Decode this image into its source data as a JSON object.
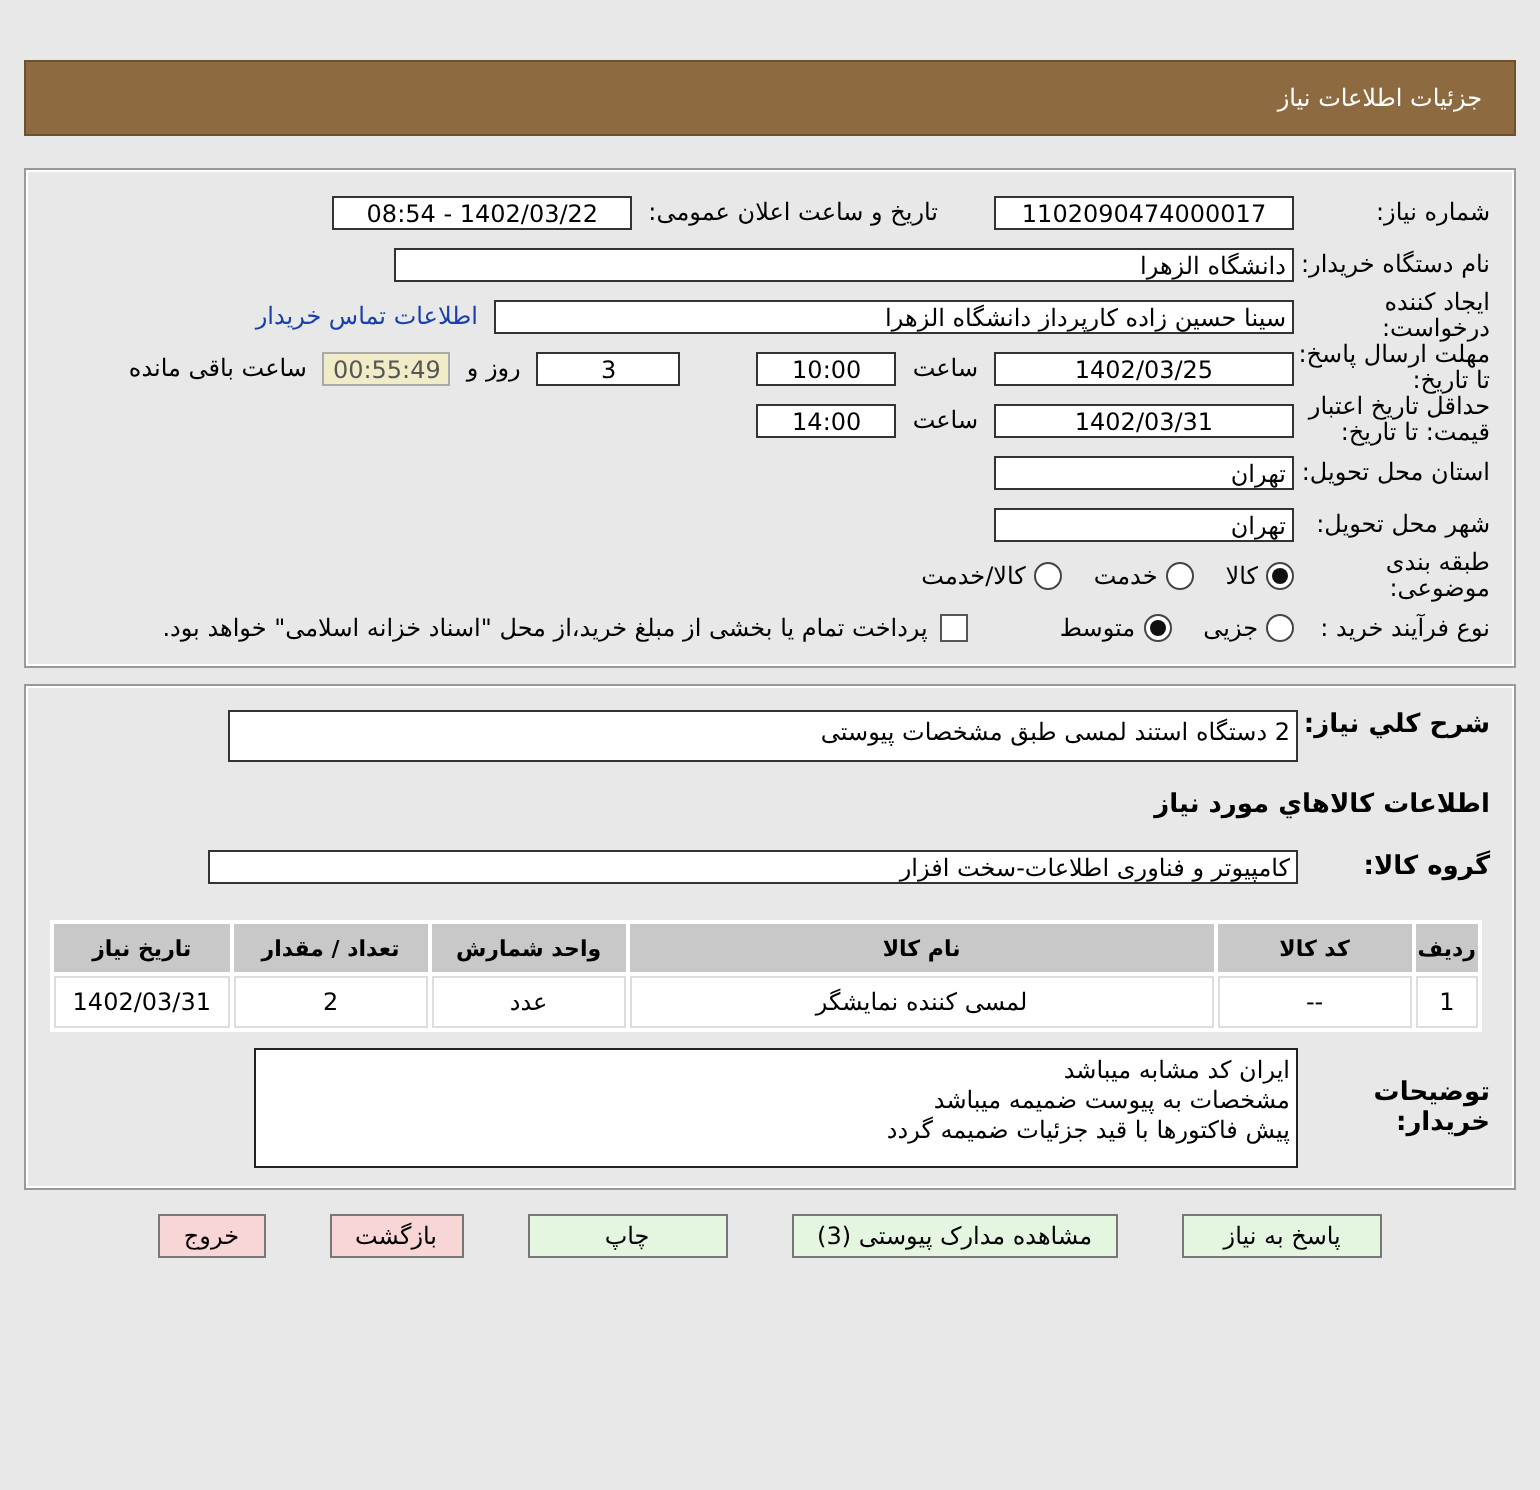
{
  "header": {
    "title": "جزئیات اطلاعات نیاز"
  },
  "details": {
    "need_number": {
      "label": "شماره نیاز:",
      "value": "1102090474000017"
    },
    "announce": {
      "label": "تاریخ و ساعت اعلان عمومی:",
      "value": "1402/03/22 - 08:54"
    },
    "buyer_org": {
      "label": "نام دستگاه خریدار:",
      "value": "دانشگاه الزهرا"
    },
    "requester": {
      "label": "ایجاد کننده درخواست:",
      "value": "سینا حسین زاده کارپرداز دانشگاه الزهرا",
      "link": "اطلاعات تماس خریدار"
    },
    "response_deadline": {
      "label": "مهلت ارسال پاسخ: تا تاریخ:",
      "date": "1402/03/25",
      "time_label": "ساعت",
      "time": "10:00",
      "days": "3",
      "days_label": "روز و",
      "remaining": "00:55:49",
      "remaining_label": "ساعت باقی مانده"
    },
    "price_validity": {
      "label": "حداقل تاریخ اعتبار قیمت: تا تاریخ:",
      "date": "1402/03/31",
      "time_label": "ساعت",
      "time": "14:00"
    },
    "province": {
      "label": "استان محل تحویل:",
      "value": "تهران"
    },
    "city": {
      "label": "شهر محل تحویل:",
      "value": "تهران"
    },
    "category": {
      "label": "طبقه بندی موضوعی:",
      "options": [
        {
          "label": "کالا",
          "selected": true
        },
        {
          "label": "خدمت",
          "selected": false
        },
        {
          "label": "کالا/خدمت",
          "selected": false
        }
      ]
    },
    "purchase_type": {
      "label": "نوع فرآیند خرید :",
      "options": [
        {
          "label": "جزیی",
          "selected": false
        },
        {
          "label": "متوسط",
          "selected": true
        }
      ],
      "payment": {
        "label": "پرداخت تمام یا بخشی از مبلغ خرید،از محل \"اسناد خزانه اسلامی\" خواهد بود.",
        "checked": false
      }
    }
  },
  "description": {
    "label": "شرح کلي نیاز:",
    "value": "2 دستگاه استند لمسی طبق مشخصات پیوستی"
  },
  "goods_title": "اطلاعات کالاهاي مورد نیاز",
  "goods_group": {
    "label": "گروه کالا:",
    "value": "کامپیوتر و فناوری اطلاعات-سخت افزار"
  },
  "table": {
    "columns": [
      "ردیف",
      "کد کالا",
      "نام کالا",
      "واحد شمارش",
      "تعداد / مقدار",
      "تاریخ نیاز"
    ],
    "rows": [
      [
        "1",
        "--",
        "لمسی کننده نمایشگر",
        "عدد",
        "2",
        "1402/03/31"
      ]
    ]
  },
  "buyer_notes": {
    "label": "توضیحات خریدار:",
    "lines": [
      "ایران کد مشابه میباشد",
      "مشخصات به پیوست ضمیمه میباشد",
      "پیش فاکتورها با قید جزئیات ضمیمه گردد"
    ]
  },
  "buttons": [
    {
      "label": "پاسخ به نیاز",
      "kind": "action"
    },
    {
      "label": "مشاهده مدارک پیوستی (3)",
      "kind": "action"
    },
    {
      "label": "چاپ",
      "kind": "action"
    },
    {
      "label": "بازگشت",
      "kind": "exit"
    },
    {
      "label": "خروج",
      "kind": "exit"
    }
  ]
}
